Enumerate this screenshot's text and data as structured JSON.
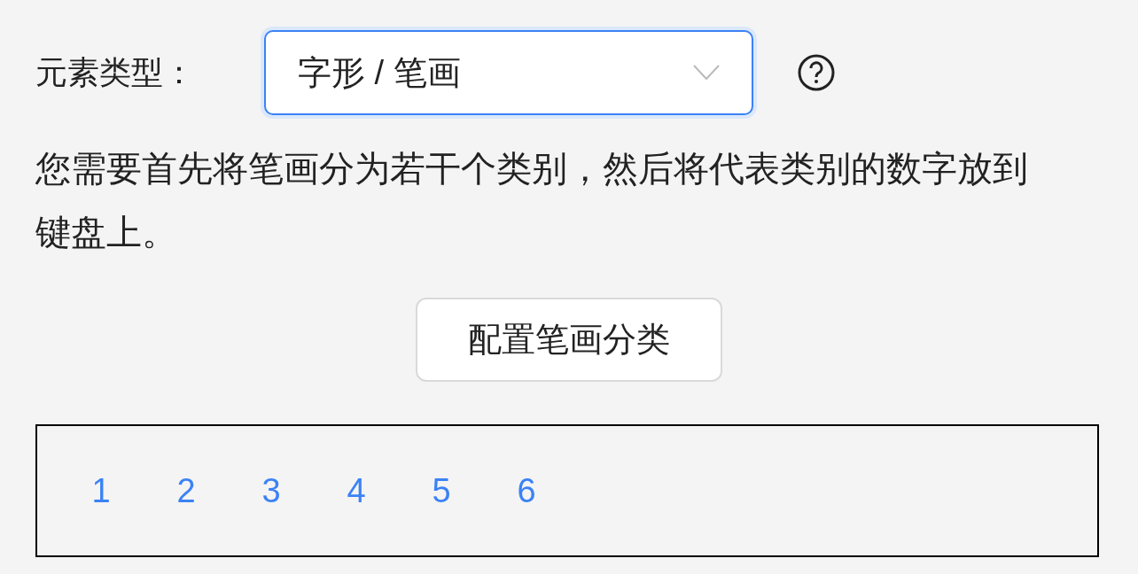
{
  "element_type": {
    "label": "元素类型：",
    "value": "字形 / 笔画",
    "focused": true
  },
  "description": "您需要首先将笔画分为若干个类别，然后将代表类别的数字放到键盘上。",
  "configure_button": "配置笔画分类",
  "keyboard": {
    "keys": [
      "1",
      "2",
      "3",
      "4",
      "5",
      "6"
    ]
  }
}
